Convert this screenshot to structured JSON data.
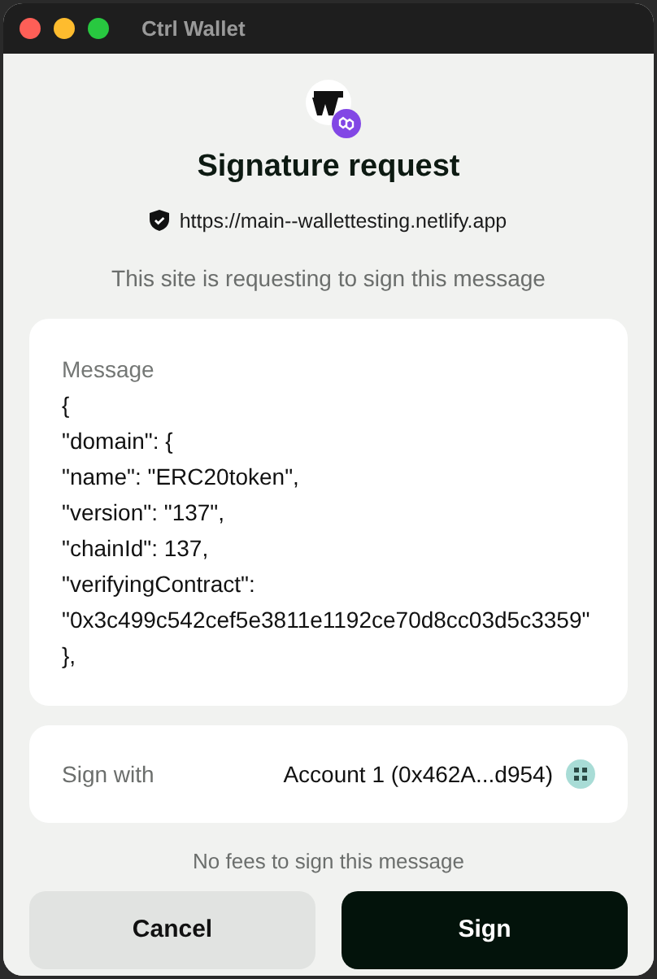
{
  "window": {
    "title": "Ctrl Wallet"
  },
  "header": {
    "title": "Signature request",
    "url": "https://main--wallettesting.netlify.app",
    "subtitle": "This site is requesting to sign this message"
  },
  "message": {
    "label": "Message",
    "lines": [
      "{",
      "\"domain\": {",
      "\"name\": \"ERC20token\",",
      "\"version\": \"137\",",
      "\"chainId\": 137,",
      "\"verifyingContract\":",
      "\"0x3c499c542cef5e3811e1192ce70d8cc03d5c3359\"",
      "},"
    ]
  },
  "sign_with": {
    "label": "Sign with",
    "account": "Account 1 (0x462A...d954)"
  },
  "fee_note": "No fees to sign this message",
  "buttons": [
    {
      "label": "Cancel",
      "kind": "secondary"
    },
    {
      "label": "Sign",
      "kind": "primary"
    }
  ]
}
